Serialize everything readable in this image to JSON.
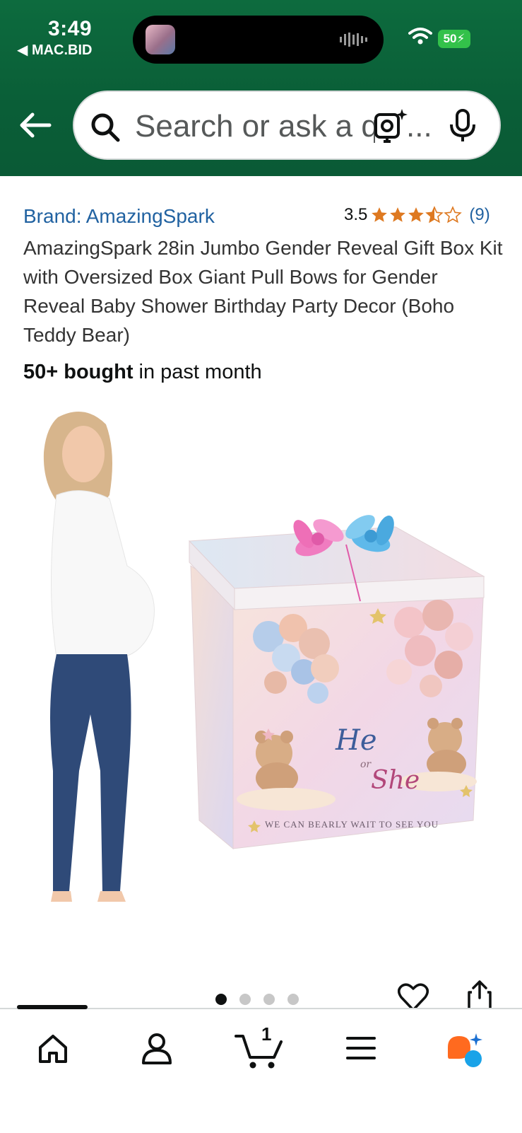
{
  "status_bar": {
    "time": "3:49",
    "back_app": "◀ MAC.BID",
    "battery": "50"
  },
  "search": {
    "placeholder": "Search or ask a qu",
    "ellipsis": "..."
  },
  "product": {
    "brand": "Brand: AmazingSpark",
    "rating_value": "3.5",
    "rating_stars": 3.5,
    "rating_count": "(9)",
    "title": "AmazingSpark 28in Jumbo Gender Reveal Gift Box Kit with Oversized Box Giant Pull Bows for Gender Reveal Baby Shower Birthday Party Decor (Boho Teddy Bear)",
    "bought_bold": "50+ bought",
    "bought_rest": " in past month",
    "box_text_top": "WE CAN BEARLY WAIT TO SEE YOU",
    "box_he": "He",
    "box_or": "or",
    "box_she": "She",
    "box_text_bottom": "WE CAN BEARLY WAIT TO SEE YOU"
  },
  "carousel": {
    "total": 4,
    "active": 1
  },
  "bottom_nav": {
    "cart_count": "1"
  },
  "colors": {
    "header": "#0d6b3e",
    "link": "#2162a1",
    "star": "#de7921"
  }
}
